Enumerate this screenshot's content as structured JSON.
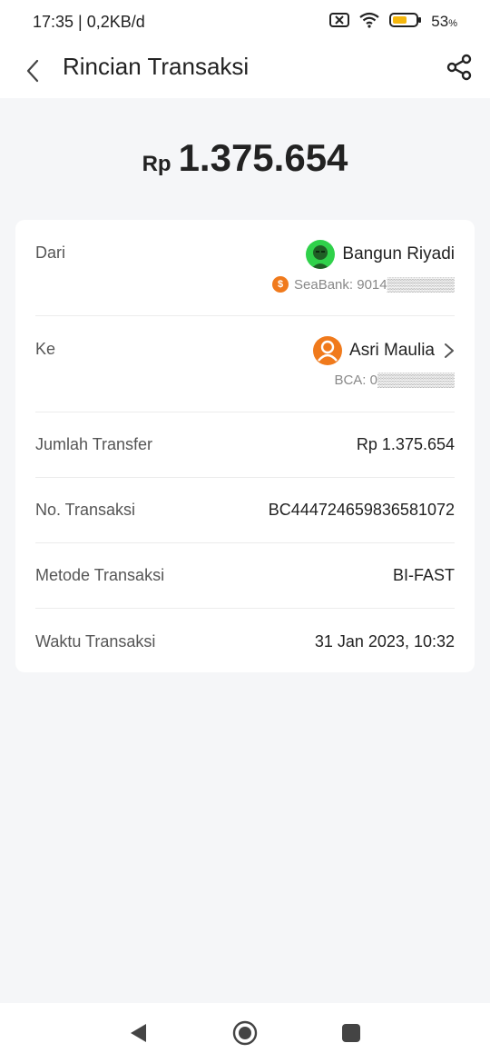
{
  "status_bar": {
    "time_speed": "17:35 | 0,2KB/d",
    "battery": "53",
    "battery_suffix": "%",
    "icons": [
      "sim-off-icon",
      "wifi-icon",
      "battery-icon"
    ]
  },
  "header": {
    "title": "Rincian Transaksi",
    "back_icon": "chevron-left-icon",
    "share_icon": "share-icon"
  },
  "amount": {
    "currency": "Rp",
    "value": "1.375.654"
  },
  "details": {
    "from": {
      "label": "Dari",
      "name": "Bangun Riyadi",
      "account": "SeaBank: 9014▒▒▒▒▒▒▒"
    },
    "to": {
      "label": "Ke",
      "name": "Asri Maulia",
      "account": "BCA: 0▒▒▒▒▒▒▒▒"
    },
    "rows": [
      {
        "label": "Jumlah Transfer",
        "value": "Rp 1.375.654"
      },
      {
        "label": "No. Transaksi",
        "value": "BC444724659836581072"
      },
      {
        "label": "Metode Transaksi",
        "value": "BI-FAST"
      },
      {
        "label": "Waktu Transaksi",
        "value": "31 Jan 2023, 10:32"
      }
    ]
  },
  "colors": {
    "background": "#f5f6f8",
    "card": "#ffffff",
    "avatar_from": "#2fd14a",
    "avatar_to": "#f07a1c",
    "battery": "#f5b70d"
  }
}
